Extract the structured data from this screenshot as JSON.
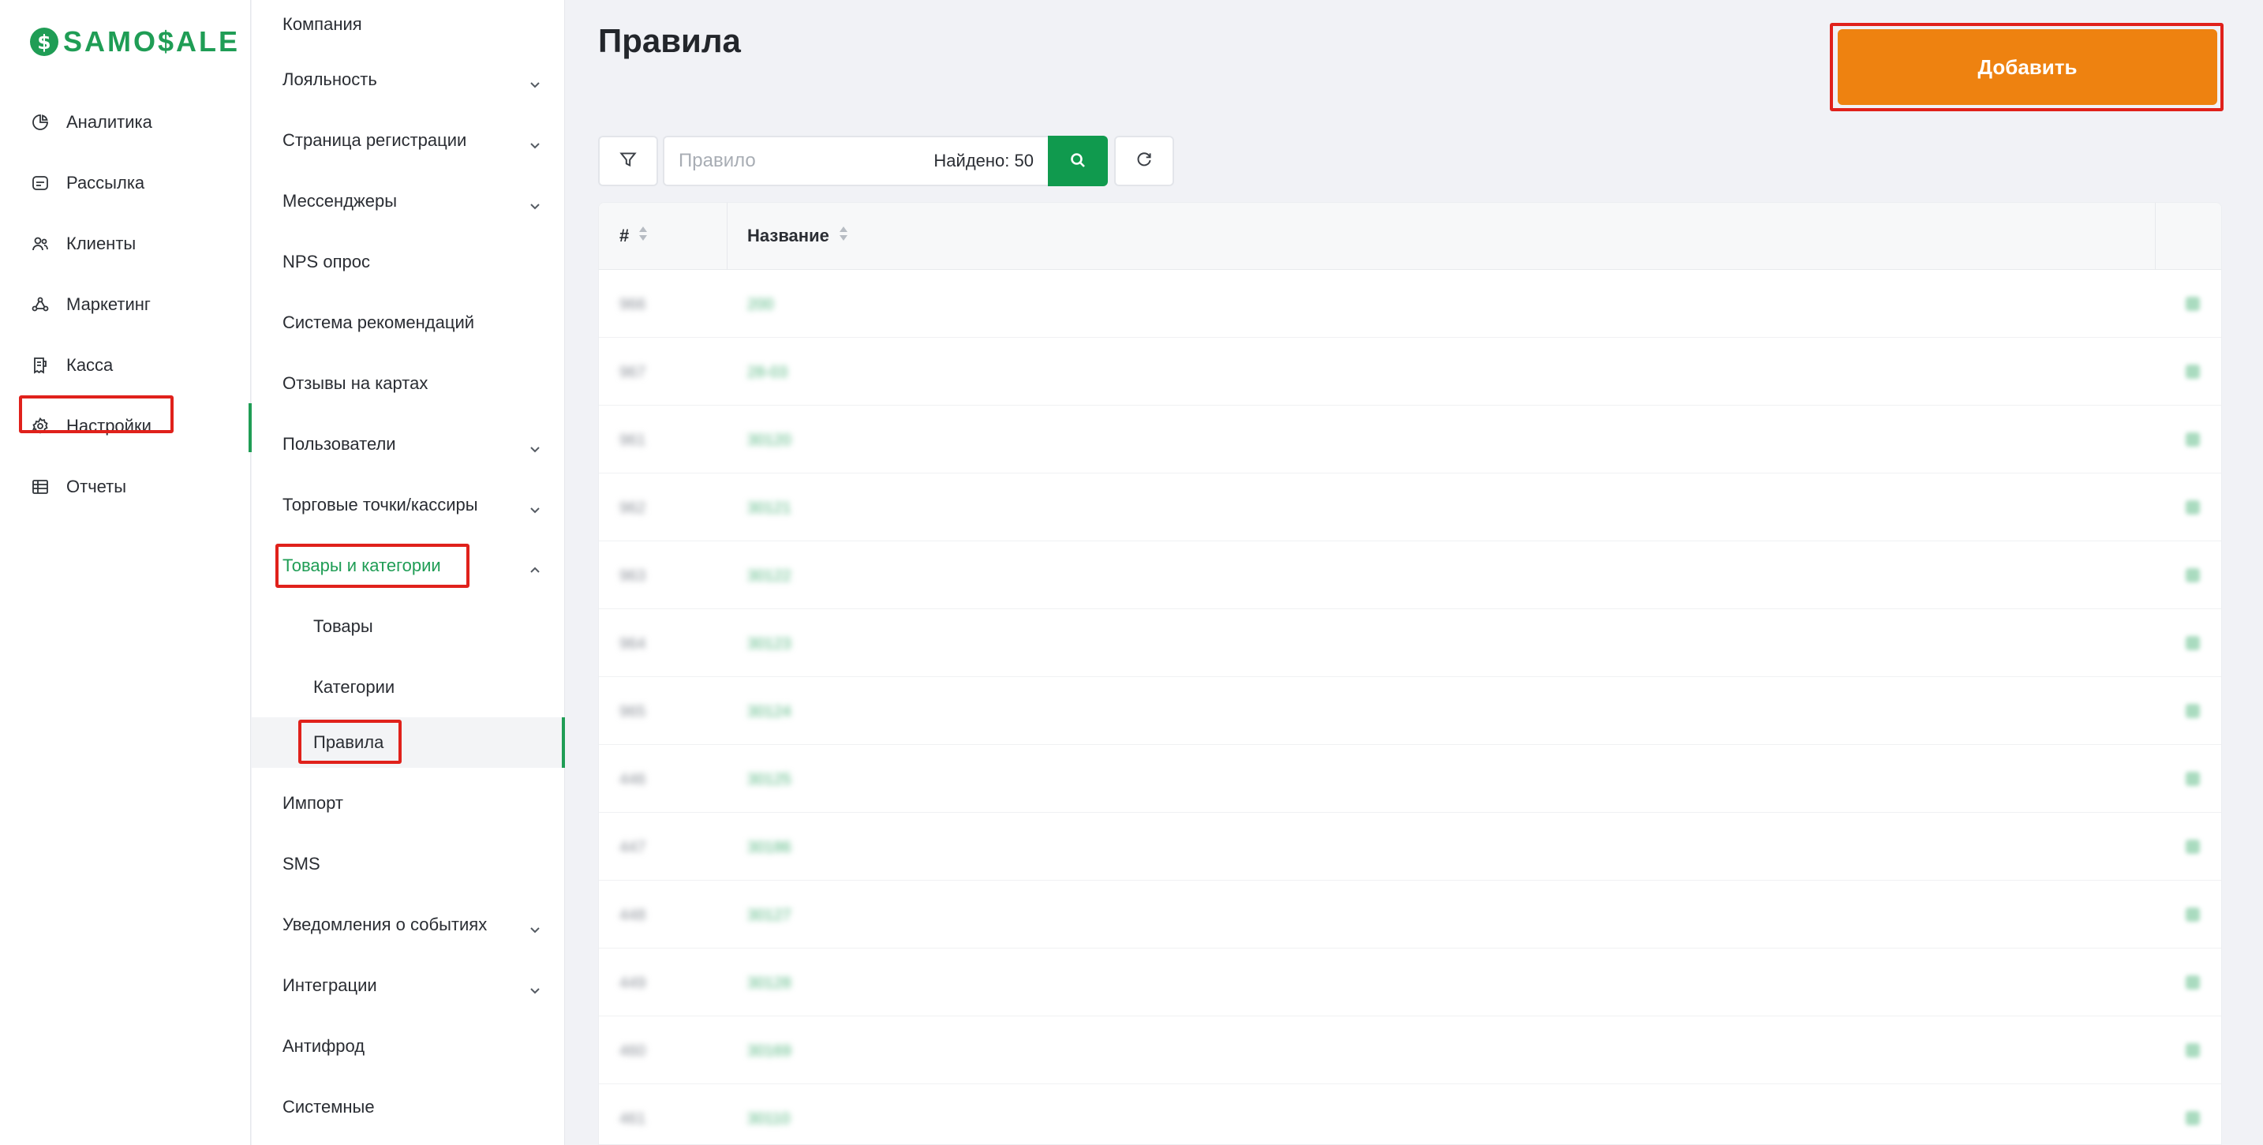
{
  "brand": {
    "logo_mark": "$",
    "logo_text": "SAMO$ALE",
    "accent": "#1f9d55",
    "add_color": "#ee8210"
  },
  "sidebar": {
    "items": [
      {
        "label": "Аналитика",
        "icon": "pie-chart-icon"
      },
      {
        "label": "Рассылка",
        "icon": "message-icon"
      },
      {
        "label": "Клиенты",
        "icon": "users-icon"
      },
      {
        "label": "Маркетинг",
        "icon": "marketing-icon"
      },
      {
        "label": "Касса",
        "icon": "receipt-icon"
      },
      {
        "label": "Настройки",
        "icon": "gear-icon",
        "active": true
      },
      {
        "label": "Отчеты",
        "icon": "table-icon"
      }
    ]
  },
  "subnav": {
    "items": [
      {
        "label": "Компания"
      },
      {
        "label": "Лояльность",
        "chevron": "down"
      },
      {
        "label": "Страница регистрации",
        "chevron": "down"
      },
      {
        "label": "Мессенджеры",
        "chevron": "down"
      },
      {
        "label": "NPS опрос"
      },
      {
        "label": "Система рекомендаций"
      },
      {
        "label": "Отзывы на картах"
      },
      {
        "label": "Пользователи",
        "chevron": "down"
      },
      {
        "label": "Торговые точки/кассиры",
        "chevron": "down"
      },
      {
        "label": "Товары и категории",
        "chevron": "up",
        "open": true
      },
      {
        "label": "Импорт"
      },
      {
        "label": "SMS"
      },
      {
        "label": "Уведомления о событиях",
        "chevron": "down"
      },
      {
        "label": "Интеграции",
        "chevron": "down"
      },
      {
        "label": "Антифрод"
      },
      {
        "label": "Системные"
      }
    ],
    "children": [
      {
        "label": "Товары"
      },
      {
        "label": "Категории"
      },
      {
        "label": "Правила",
        "current": true
      }
    ]
  },
  "main": {
    "title": "Правила",
    "add_label": "Добавить",
    "search": {
      "placeholder": "Правило",
      "found": "Найдено: 50"
    },
    "table": {
      "columns": [
        "#",
        "Название"
      ],
      "rows": [
        {
          "id": "966",
          "name": "200"
        },
        {
          "id": "967",
          "name": "28-03"
        },
        {
          "id": "961",
          "name": "30120"
        },
        {
          "id": "962",
          "name": "30121"
        },
        {
          "id": "963",
          "name": "30122"
        },
        {
          "id": "964",
          "name": "30123"
        },
        {
          "id": "965",
          "name": "30124"
        },
        {
          "id": "446",
          "name": "30125"
        },
        {
          "id": "447",
          "name": "30186"
        },
        {
          "id": "448",
          "name": "30127"
        },
        {
          "id": "449",
          "name": "30128"
        },
        {
          "id": "460",
          "name": "30169"
        },
        {
          "id": "461",
          "name": "30110"
        }
      ]
    }
  }
}
